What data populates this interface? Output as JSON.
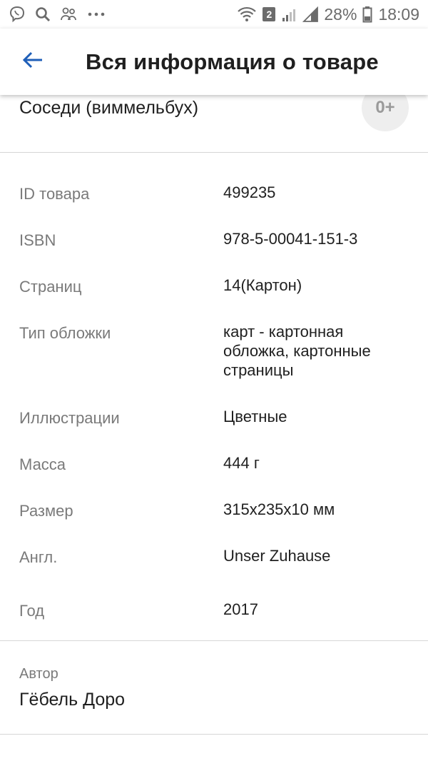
{
  "status_bar": {
    "sim_number": "2",
    "battery_percent": "28%",
    "time": "18:09"
  },
  "app_bar": {
    "title": "Вся информация о товаре"
  },
  "product": {
    "title": "Соседи (виммельбух)",
    "age_rating": "0+"
  },
  "properties": [
    {
      "label": "ID товара",
      "value": "499235"
    },
    {
      "label": "ISBN",
      "value": "978-5-00041-151-3"
    },
    {
      "label": "Страниц",
      "value": "14(Картон)"
    },
    {
      "label": "Тип обложки",
      "value": "карт - картонная обложка, картонные страницы"
    },
    {
      "label": "Иллюстрации",
      "value": "Цветные"
    },
    {
      "label": "Масса",
      "value": "444 г"
    },
    {
      "label": "Размер",
      "value": "315x235x10 мм"
    },
    {
      "label": "Англ.",
      "value": "Unser Zuhause"
    },
    {
      "label": "Год",
      "value": "2017"
    }
  ],
  "author": {
    "label": "Автор",
    "name": "Гёбель Доро"
  },
  "colors": {
    "accent": "#1f5fb8",
    "label_gray": "#7a7a7a",
    "divider": "#d6d6d6"
  }
}
